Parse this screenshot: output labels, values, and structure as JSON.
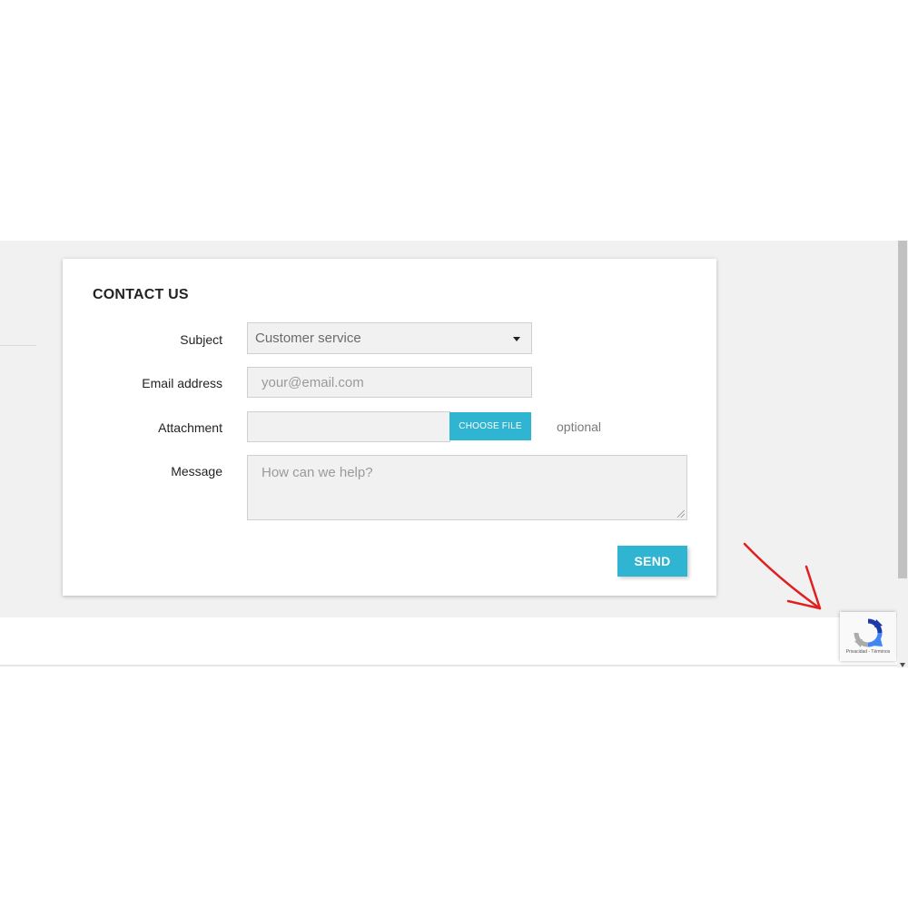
{
  "colors": {
    "accent": "#2fb5d2",
    "band_gray": "#f1f1f1",
    "field_bg": "#f1f1f1",
    "annotation_arrow": "#e02020"
  },
  "contact_form": {
    "title": "CONTACT US",
    "subject": {
      "label": "Subject",
      "selected": "Customer service"
    },
    "email": {
      "label": "Email address",
      "placeholder": "your@email.com"
    },
    "attachment": {
      "label": "Attachment",
      "button_label": "CHOOSE FILE",
      "note": "optional"
    },
    "message": {
      "label": "Message",
      "placeholder": "How can we help?"
    },
    "send_label": "SEND"
  },
  "recaptcha": {
    "icon": "recaptcha-logo-icon",
    "links": "Privacidad - Términos"
  }
}
